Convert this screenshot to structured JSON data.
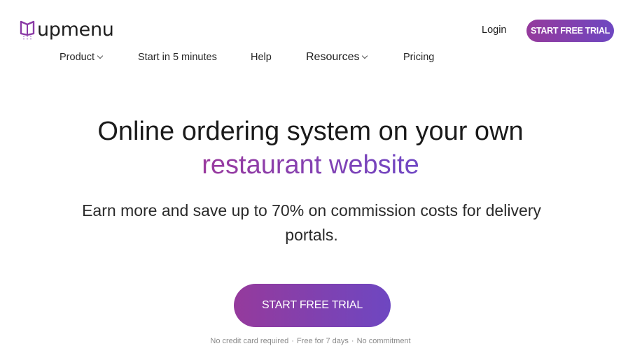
{
  "brand": {
    "name": "upmenu",
    "logo_icon": "book-menu-icon",
    "accent_start": "#953a9c",
    "accent_end": "#6e47c1"
  },
  "header": {
    "login_label": "Login",
    "cta_label": "START FREE TRIAL"
  },
  "nav": {
    "items": [
      {
        "label": "Product",
        "has_dropdown": true
      },
      {
        "label": "Start in 5 minutes",
        "has_dropdown": false
      },
      {
        "label": "Help",
        "has_dropdown": false
      },
      {
        "label": "Resources",
        "has_dropdown": true
      },
      {
        "label": "Pricing",
        "has_dropdown": false
      }
    ]
  },
  "hero": {
    "headline_line1": "Online ordering system on your own",
    "headline_accent": "restaurant website",
    "subtitle": "Earn more and save up to 70% on commission costs for delivery portals.",
    "cta_label": "START FREE TRIAL",
    "notes": [
      "No credit card required",
      "Free for 7 days",
      "No commitment"
    ],
    "note_separator": "·"
  }
}
